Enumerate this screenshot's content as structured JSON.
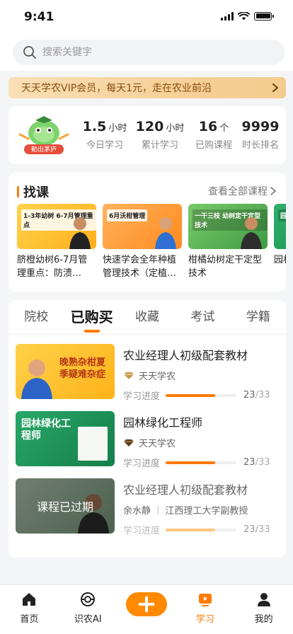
{
  "status_bar": {
    "time": "9:41"
  },
  "search": {
    "placeholder": "搜索关键字"
  },
  "vip_banner": {
    "text": "天天学农VIP会员，每天1元，走在农业前沿"
  },
  "stats": {
    "badge": "勤出茅庐",
    "items": [
      {
        "value": "1.5",
        "unit": "小时",
        "label": "今日学习"
      },
      {
        "value": "120",
        "unit": "小时",
        "label": "累计学习"
      },
      {
        "value": "16",
        "unit": "个",
        "label": "已购课程"
      },
      {
        "value": "9999",
        "unit": "",
        "label": "时长排名"
      }
    ]
  },
  "find_courses": {
    "title": "找课",
    "see_all": "查看全部课程",
    "courses": [
      {
        "thumb_text": "1-3年幼树 6-7月管理重点",
        "title": "脐橙幼树6-7月管理重点：防溃…"
      },
      {
        "thumb_text": "6月沃柑管理",
        "title": "快速学会全年种植管理技术（定植…"
      },
      {
        "thumb_text": "一干三枝 幼树定干定型技术",
        "title": "柑橘幼树定干定型技术"
      },
      {
        "thumb_text": "园林",
        "title": "园林"
      }
    ]
  },
  "learning": {
    "tabs": [
      "院校",
      "已购买",
      "收藏",
      "考试",
      "学籍"
    ],
    "active_tab": "已购买",
    "items": [
      {
        "thumb_text": "晚熟杂柑夏季疑难杂症",
        "name": "农业经理人初级配套教材",
        "org": "天天学农",
        "progress_label": "学习进度",
        "progress_done": "23",
        "progress_total": "/33",
        "progress": 0.7
      },
      {
        "thumb_text": "园林绿化工程师",
        "name": "园林绿化工程师",
        "org": "天天学农",
        "progress_label": "学习进度",
        "progress_done": "23",
        "progress_total": "/33",
        "progress": 0.7
      },
      {
        "thumb_text": "课程已过期",
        "name": "农业经理人初级配套教材",
        "teacher": "余水静",
        "org": "江西理工大学副教授",
        "progress_label": "学习进度",
        "progress_done": "23",
        "progress_total": "/33",
        "progress": 0.7
      }
    ]
  },
  "tab_bar": {
    "items": [
      {
        "label": "首页",
        "icon": "home-icon"
      },
      {
        "label": "识农AI",
        "icon": "ai-icon"
      },
      {
        "label": "",
        "icon": "plus-icon"
      },
      {
        "label": "学习",
        "icon": "play-icon"
      },
      {
        "label": "我的",
        "icon": "user-icon"
      }
    ],
    "active": "学习"
  },
  "colors": {
    "accent": "#ff7a00",
    "banner_text": "#8a4b12"
  }
}
